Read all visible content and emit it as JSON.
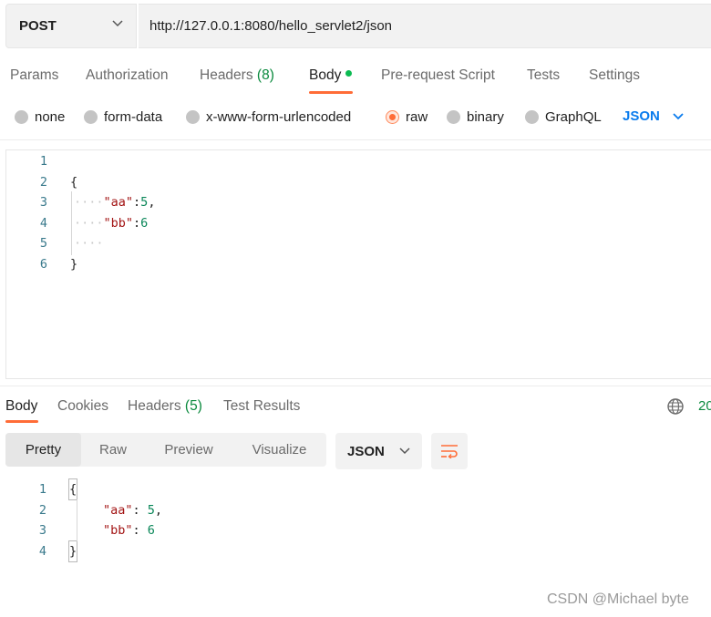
{
  "request": {
    "method": "POST",
    "url": "http://127.0.0.1:8080/hello_servlet2/json"
  },
  "request_tabs": {
    "params": "Params",
    "authorization": "Authorization",
    "headers": "Headers",
    "headers_count": "(8)",
    "body": "Body",
    "pre_request": "Pre-request Script",
    "tests": "Tests",
    "settings": "Settings"
  },
  "body_types": {
    "none": "none",
    "form_data": "form-data",
    "urlencoded": "x-www-form-urlencoded",
    "raw": "raw",
    "binary": "binary",
    "graphql": "GraphQL",
    "selected": "raw",
    "format": "JSON"
  },
  "request_body": {
    "line_numbers": [
      "1",
      "2",
      "3",
      "4",
      "5",
      "6"
    ],
    "open_brace": "{",
    "close_brace": "}",
    "key_aa": "\"aa\"",
    "val_aa": "5",
    "key_bb": "\"bb\"",
    "val_bb": "6",
    "colon": ":",
    "comma": ",",
    "indent_dots": "····"
  },
  "response_tabs": {
    "body": "Body",
    "cookies": "Cookies",
    "headers": "Headers",
    "headers_count": "(5)",
    "test_results": "Test Results",
    "status": "20"
  },
  "response_view": {
    "pretty": "Pretty",
    "raw": "Raw",
    "preview": "Preview",
    "visualize": "Visualize",
    "format": "JSON"
  },
  "response_body": {
    "line_numbers": [
      "1",
      "2",
      "3",
      "4"
    ],
    "open_brace": "{",
    "close_brace": "}",
    "key_aa": "\"aa\"",
    "val_aa": "5",
    "key_bb": "\"bb\"",
    "val_bb": "6",
    "colon_space": ": ",
    "comma": ","
  },
  "watermark": "CSDN @Michael byte",
  "colors": {
    "accent": "#ff6c37",
    "active_dot": "#0cbb52",
    "link_blue": "#097bed",
    "count_green": "#0b8a3e",
    "json_key": "#a31515",
    "json_number": "#098658"
  }
}
